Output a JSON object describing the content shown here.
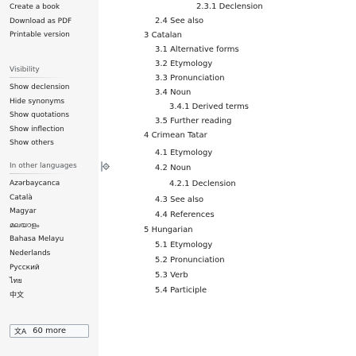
{
  "sidebar": {
    "print_links": [
      "Create a book",
      "Download as PDF",
      "Printable version"
    ],
    "visibility": {
      "heading": "Visibility",
      "links": [
        "Show declension",
        "Hide synonyms",
        "Show quotations",
        "Show inflection",
        "Show others"
      ]
    },
    "languages": {
      "heading": "In other languages",
      "links": [
        "Azərbaycanca",
        "Català",
        "Magyar",
        "മലയാളം",
        "Bahasa Melayu",
        "Nederlands",
        "Русский",
        "ไทย",
        "中文"
      ],
      "more_icon": "文A",
      "more_label": "60 more"
    }
  },
  "toc": [
    {
      "num": "2.3.1",
      "text": "Declension",
      "level": 3
    },
    {
      "num": "2.4",
      "text": "See also",
      "level": 2
    },
    {
      "num": "3",
      "text": "Catalan",
      "level": 1
    },
    {
      "num": "3.1",
      "text": "Alternative forms",
      "level": 2
    },
    {
      "num": "3.2",
      "text": "Etymology",
      "level": 2
    },
    {
      "num": "3.3",
      "text": "Pronunciation",
      "level": 2
    },
    {
      "num": "3.4",
      "text": "Noun",
      "level": 2
    },
    {
      "num": "3.4.1",
      "text": "Derived terms",
      "level": 3
    },
    {
      "num": "3.5",
      "text": "Further reading",
      "level": 2
    },
    {
      "num": "4",
      "text": "Crimean Tatar",
      "level": 1
    },
    {
      "num": "4.1",
      "text": "Etymology",
      "level": 2
    },
    {
      "num": "4.2",
      "text": "Noun",
      "level": 2
    },
    {
      "num": "4.2.1",
      "text": "Declension",
      "level": 3
    },
    {
      "num": "4.3",
      "text": "See also",
      "level": 2
    },
    {
      "num": "4.4",
      "text": "References",
      "level": 2
    },
    {
      "num": "5",
      "text": "Hungarian",
      "level": 1
    },
    {
      "num": "5.1",
      "text": "Etymology",
      "level": 2
    },
    {
      "num": "5.2",
      "text": "Pronunciation",
      "level": 2
    },
    {
      "num": "5.3",
      "text": "Verb",
      "level": 2
    },
    {
      "num": "5.4",
      "text": "Participle",
      "level": 2
    }
  ]
}
